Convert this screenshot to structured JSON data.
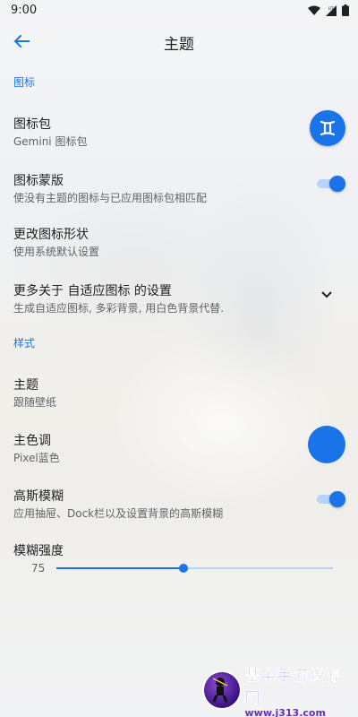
{
  "status_bar": {
    "time": "9:00",
    "icons": [
      "wifi-icon",
      "signal-icon",
      "battery-icon"
    ]
  },
  "header": {
    "title": "主题",
    "back_icon": "arrow-left-icon"
  },
  "sections": {
    "icons_header": "图标",
    "style_header": "样式"
  },
  "icon_pack": {
    "title": "图标包",
    "subtitle": "Gemini 图标包",
    "badge_glyph": "♊",
    "badge_color": "#1a73e8"
  },
  "icon_mask": {
    "title": "图标蒙版",
    "subtitle": "使没有主题的图标与已应用图标包相匹配",
    "enabled": true
  },
  "icon_shape": {
    "title": "更改图标形状",
    "subtitle": "使用系统默认设置"
  },
  "adaptive": {
    "title": "更多关于 自适应图标 的设置",
    "subtitle": "生成自适应图标, 多彩背景, 用白色背景代替.",
    "chevron_icon": "chevron-down-icon"
  },
  "theme": {
    "title": "主题",
    "subtitle": "跟随壁纸"
  },
  "accent": {
    "title": "主色调",
    "subtitle": "Pixel蓝色",
    "color": "#1a73e8"
  },
  "blur": {
    "title": "高斯模糊",
    "subtitle": "应用抽屉、Dock栏以及设置背景的高斯模糊",
    "enabled": true
  },
  "blur_strength": {
    "title": "模糊强度",
    "value": "75",
    "fraction": 0.46
  },
  "watermark": {
    "name": "基伞手游资源网",
    "url": "www.j313.com"
  },
  "colors": {
    "accent": "#1a73e8",
    "track": "#b9d3f8"
  }
}
